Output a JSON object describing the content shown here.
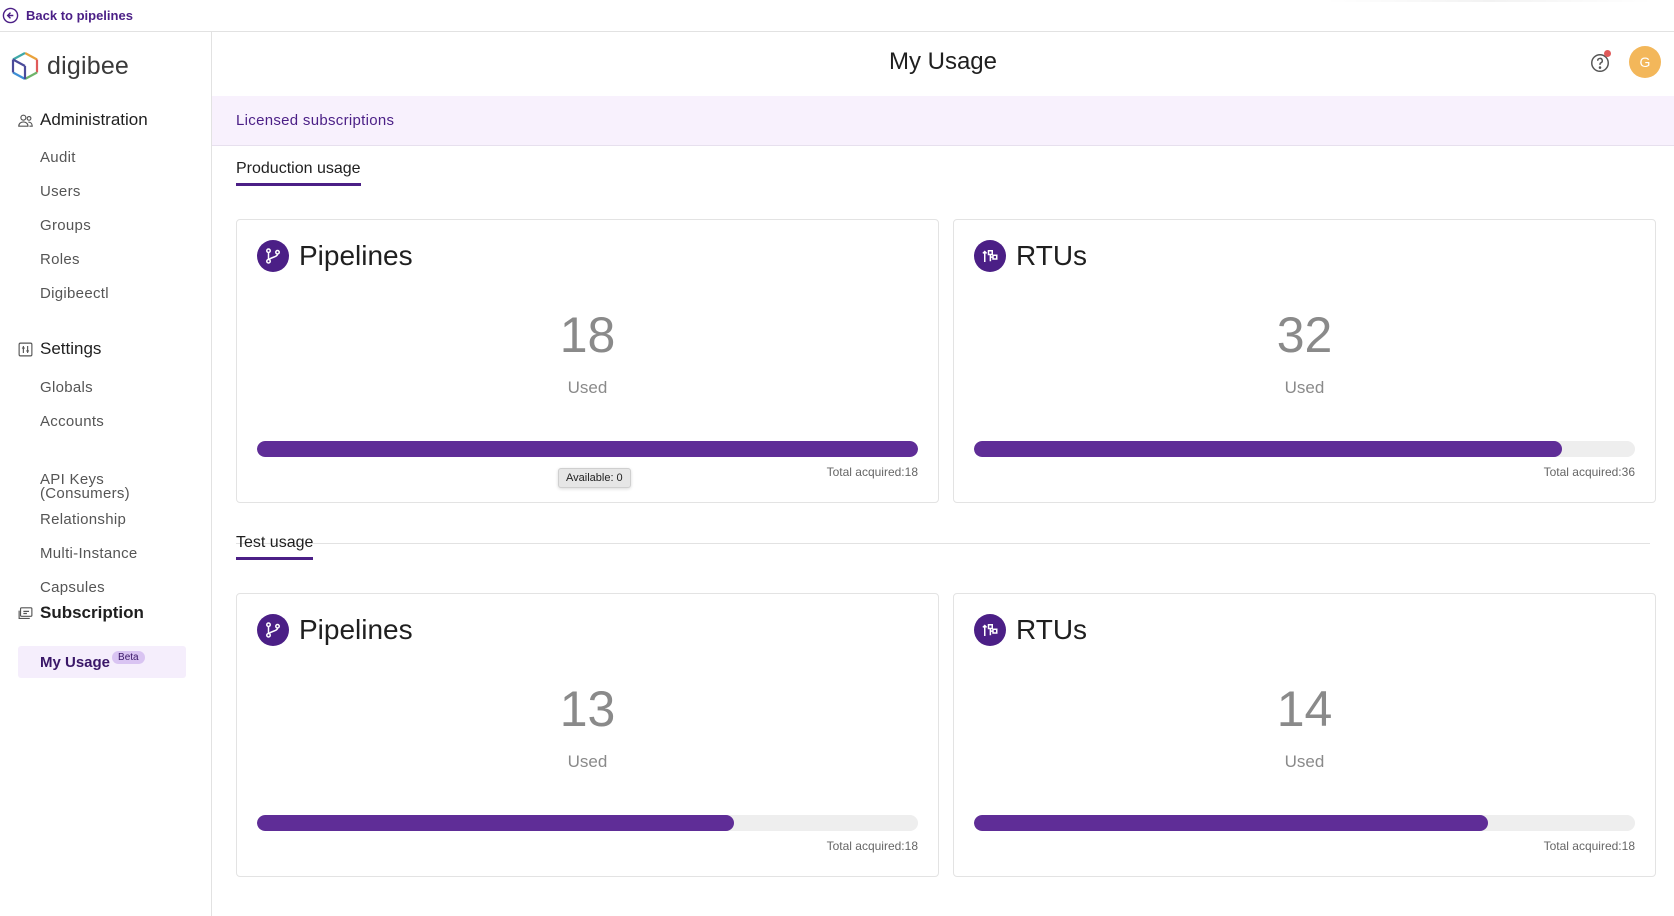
{
  "topbar": {
    "back_label": "Back to pipelines"
  },
  "brand": {
    "name": "digibee"
  },
  "sidebar": {
    "administration": {
      "title": "Administration",
      "items": [
        "Audit",
        "Users",
        "Groups",
        "Roles",
        "Digibeectl"
      ]
    },
    "settings": {
      "title": "Settings",
      "items": [
        "Globals",
        "Accounts",
        "API Keys (Consumers)",
        "Relationship",
        "Multi-Instance",
        "Capsules"
      ]
    },
    "subscription": {
      "title": "Subscription",
      "active_item": "My Usage",
      "badge": "Beta"
    }
  },
  "header": {
    "title": "My Usage",
    "avatar_initial": "G"
  },
  "licensed": {
    "label": "Licensed subscriptions"
  },
  "production": {
    "tab": "Production usage",
    "pipelines": {
      "title": "Pipelines",
      "used": 18,
      "used_label": "Used",
      "total": 18,
      "total_label": "Total acquired:18",
      "tooltip": "Available:  0"
    },
    "rtus": {
      "title": "RTUs",
      "used": 32,
      "used_label": "Used",
      "total": 36,
      "total_label": "Total acquired:36"
    }
  },
  "test": {
    "tab": "Test usage",
    "pipelines": {
      "title": "Pipelines",
      "used": 13,
      "used_label": "Used",
      "total": 18,
      "total_label": "Total acquired:18"
    },
    "rtus": {
      "title": "RTUs",
      "used": 14,
      "used_label": "Used",
      "total": 18,
      "total_label": "Total acquired:18"
    }
  },
  "colors": {
    "accent": "#4b1f86",
    "bar": "#5f2d97",
    "avatar": "#f3b75a",
    "licensed_bg": "#f8f1fd"
  },
  "icons": {
    "back": "arrow-left-circle-icon",
    "pipelines": "git-branch-icon",
    "rtus": "rtu-icon",
    "help": "help-circle-icon"
  }
}
